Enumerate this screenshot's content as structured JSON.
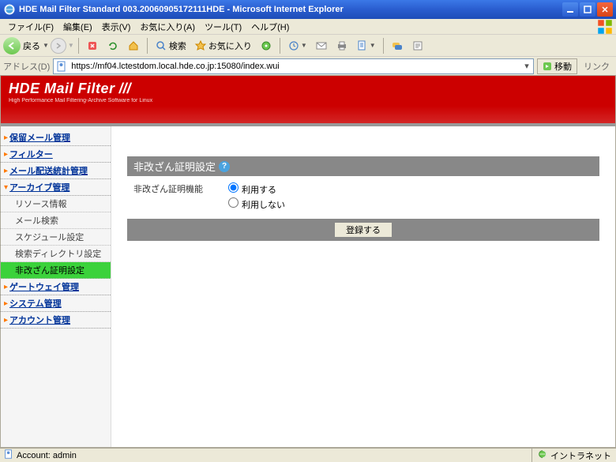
{
  "window": {
    "title": "HDE Mail Filter Standard 003.20060905172111HDE - Microsoft Internet Explorer"
  },
  "menubar": {
    "items": [
      "ファイル(F)",
      "編集(E)",
      "表示(V)",
      "お気に入り(A)",
      "ツール(T)",
      "ヘルプ(H)"
    ]
  },
  "toolbar": {
    "back_label": "戻る",
    "search_label": "検索",
    "favorites_label": "お気に入り"
  },
  "addressbar": {
    "label": "アドレス(D)",
    "url": "https://mf04.lctestdom.local.hde.co.jp:15080/index.wui",
    "go_label": "移動",
    "links_label": "リンク"
  },
  "app": {
    "logo_main": "HDE Mail Filter",
    "logo_stripes": "///",
    "logo_sub": "High Performance Mail Filtering-Archive Software for Linux"
  },
  "sidebar": {
    "items": [
      {
        "label": "保留メール管理",
        "expanded": false
      },
      {
        "label": "フィルター",
        "expanded": false
      },
      {
        "label": "メール配送統計管理",
        "expanded": false
      },
      {
        "label": "アーカイブ管理",
        "expanded": true,
        "children": [
          {
            "label": "リソース情報"
          },
          {
            "label": "メール検索"
          },
          {
            "label": "スケジュール設定"
          },
          {
            "label": "検索ディレクトリ設定"
          },
          {
            "label": "非改ざん証明設定",
            "active": true
          }
        ]
      },
      {
        "label": "ゲートウェイ管理",
        "expanded": false
      },
      {
        "label": "システム管理",
        "expanded": false
      },
      {
        "label": "アカウント管理",
        "expanded": false
      }
    ]
  },
  "main": {
    "section_title": "非改ざん証明設定",
    "field_label": "非改ざん証明機能",
    "option_use": "利用する",
    "option_not_use": "利用しない",
    "selected": "use",
    "submit_label": "登録する"
  },
  "statusbar": {
    "account_label": "Account: admin",
    "zone_label": "イントラネット"
  }
}
